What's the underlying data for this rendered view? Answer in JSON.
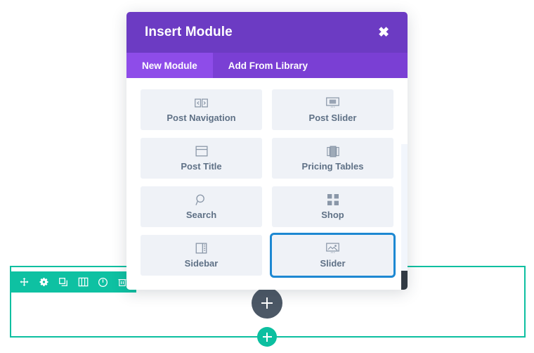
{
  "modal": {
    "title": "Insert Module",
    "close_label": "✖",
    "tabs": [
      {
        "label": "New Module",
        "active": true
      },
      {
        "label": "Add From Library",
        "active": false
      }
    ],
    "modules": [
      {
        "label": "Post Navigation",
        "icon": "post-navigation-icon",
        "selected": false
      },
      {
        "label": "Post Slider",
        "icon": "post-slider-icon",
        "selected": false
      },
      {
        "label": "Post Title",
        "icon": "post-title-icon",
        "selected": false
      },
      {
        "label": "Pricing Tables",
        "icon": "pricing-tables-icon",
        "selected": false
      },
      {
        "label": "Search",
        "icon": "search-icon",
        "selected": false
      },
      {
        "label": "Shop",
        "icon": "shop-icon",
        "selected": false
      },
      {
        "label": "Sidebar",
        "icon": "sidebar-icon",
        "selected": false
      },
      {
        "label": "Slider",
        "icon": "slider-icon",
        "selected": true
      }
    ],
    "colors": {
      "header": "#6c3bc3",
      "tab_bar": "#7a3fd4",
      "tab_active": "#8e4ce9",
      "tile": "#eff2f7",
      "tile_label": "#5f7186",
      "selection_ring": "#1d88d2",
      "scrollbar_thumb": "#313a44"
    }
  },
  "builder": {
    "row_toolbar": {
      "icons": [
        "move-icon",
        "settings-gear-icon",
        "duplicate-icon",
        "columns-icon",
        "power-toggle-icon",
        "trash-icon"
      ]
    },
    "add_module_button": {
      "icon": "plus-icon"
    },
    "add_row_button": {
      "icon": "plus-icon"
    },
    "colors": {
      "row_border": "#0cbfa0",
      "toolbar": "#0ec1a2",
      "add_module": "#4c5866",
      "add_row": "#0cbfa0"
    }
  }
}
